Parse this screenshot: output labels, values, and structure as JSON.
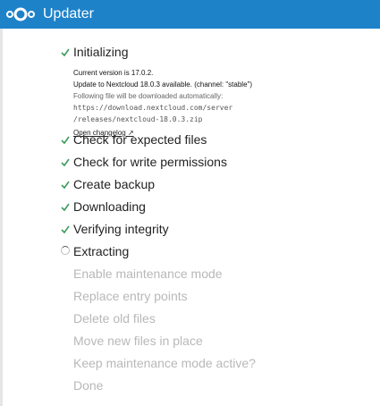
{
  "header": {
    "title": "Updater",
    "logo_icon": "nextcloud-logo-icon"
  },
  "colors": {
    "header_bg": "#1e82c9",
    "check": "#3d9b5c"
  },
  "steps": [
    {
      "label": "Initializing",
      "status": "done"
    },
    {
      "label": "Check for expected files",
      "status": "done"
    },
    {
      "label": "Check for write permissions",
      "status": "done"
    },
    {
      "label": "Create backup",
      "status": "done"
    },
    {
      "label": "Downloading",
      "status": "done"
    },
    {
      "label": "Verifying integrity",
      "status": "done"
    },
    {
      "label": "Extracting",
      "status": "in-progress"
    },
    {
      "label": "Enable maintenance mode",
      "status": "pending"
    },
    {
      "label": "Replace entry points",
      "status": "pending"
    },
    {
      "label": "Delete old files",
      "status": "pending"
    },
    {
      "label": "Move new files in place",
      "status": "pending"
    },
    {
      "label": "Keep maintenance mode active?",
      "status": "pending"
    },
    {
      "label": "Done",
      "status": "pending"
    }
  ],
  "init_details": {
    "current_version": "Current version is 17.0.2.",
    "update_available": "Update to Nextcloud 18.0.3 available. (channel: \"stable\")",
    "download_text": "Following file will be downloaded automatically:",
    "download_url_part1": "https://download.nextcloud.com/server",
    "download_url_part2": "/releases/nextcloud-18.0.3.zip",
    "changelog_link": "Open changelog ↗"
  }
}
